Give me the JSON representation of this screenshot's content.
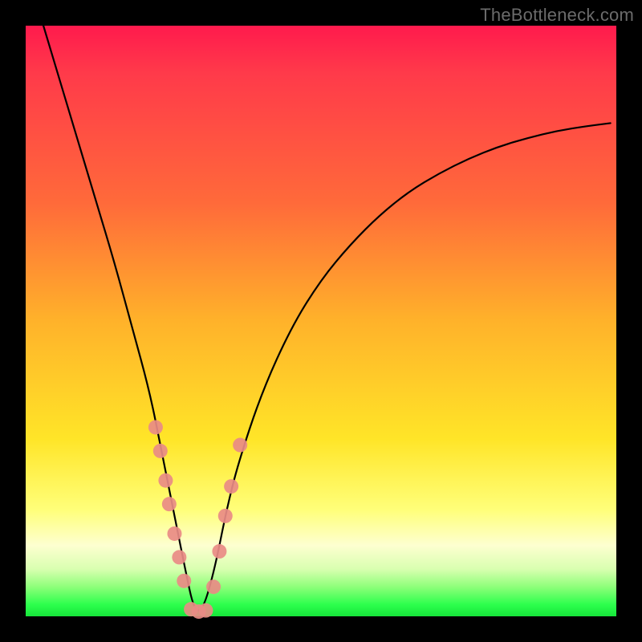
{
  "watermark": "TheBottleneck.com",
  "chart_data": {
    "type": "line",
    "title": "",
    "xlabel": "",
    "ylabel": "",
    "xlim": [
      0,
      100
    ],
    "ylim": [
      0,
      100
    ],
    "grid": false,
    "legend": false,
    "annotations": [],
    "series": [
      {
        "name": "bottleneck-curve",
        "color": "#000000",
        "x": [
          3,
          6,
          9,
          12,
          15,
          18,
          21,
          23,
          25,
          27,
          28.5,
          30,
          32,
          34,
          36,
          40,
          45,
          50,
          55,
          60,
          65,
          70,
          75,
          80,
          85,
          90,
          95,
          99
        ],
        "y": [
          100,
          90,
          80,
          70,
          60,
          49,
          38,
          28,
          18,
          8,
          1,
          1,
          8,
          18,
          26,
          38,
          49,
          57,
          63,
          68,
          72,
          75,
          77.5,
          79.5,
          81,
          82.2,
          83,
          83.5
        ]
      }
    ],
    "markers": [
      {
        "name": "curve-dots",
        "color": "#e98b86",
        "radius_px": 9,
        "points": [
          {
            "x": 22.0,
            "y": 32
          },
          {
            "x": 22.8,
            "y": 28
          },
          {
            "x": 23.7,
            "y": 23
          },
          {
            "x": 24.3,
            "y": 19
          },
          {
            "x": 25.2,
            "y": 14
          },
          {
            "x": 26.0,
            "y": 10
          },
          {
            "x": 26.8,
            "y": 6
          },
          {
            "x": 28.0,
            "y": 1.2
          },
          {
            "x": 29.3,
            "y": 0.8
          },
          {
            "x": 30.5,
            "y": 1.0
          },
          {
            "x": 31.8,
            "y": 5
          },
          {
            "x": 32.8,
            "y": 11
          },
          {
            "x": 33.8,
            "y": 17
          },
          {
            "x": 34.8,
            "y": 22
          },
          {
            "x": 36.3,
            "y": 29
          }
        ]
      }
    ]
  }
}
